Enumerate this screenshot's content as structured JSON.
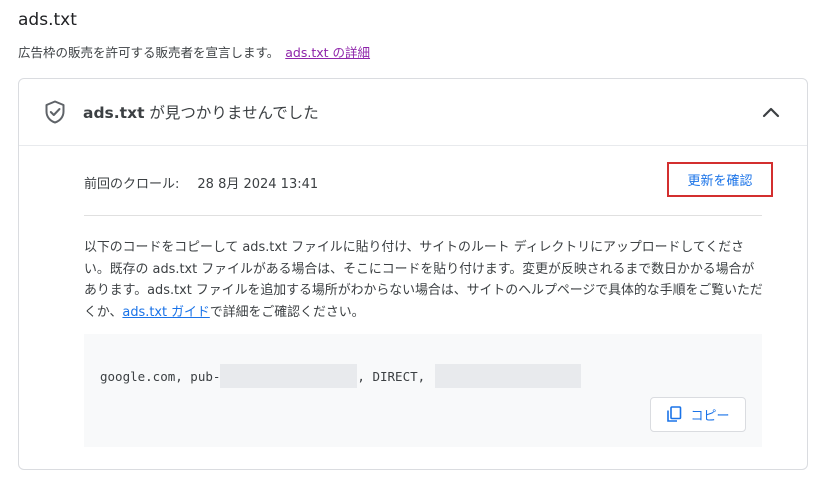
{
  "section": {
    "title": "ads.txt",
    "subtitle": "広告枠の販売を許可する販売者を宣言します。",
    "details_link": "ads.txt の詳細"
  },
  "card": {
    "status_name": "ads.txt",
    "status_text": " が見つかりませんでした",
    "icon": "shield-check-icon",
    "collapse_icon": "chevron-up-icon"
  },
  "crawl": {
    "label": "前回のクロール:",
    "value": "28 8月 2024 13:41",
    "refresh_label": "更新を確認"
  },
  "instructions": {
    "text_before_link": "以下のコードをコピーして ads.txt ファイルに貼り付け、サイトのルート ディレクトリにアップロードしてください。既存の ads.txt ファイルがある場合は、そこにコードを貼り付けます。変更が反映されるまで数日かかる場合があります。ads.txt ファイルを追加する場所がわからない場合は、サイトのヘルプページで具体的な手順をご覧いただくか、",
    "link": "ads.txt ガイド",
    "text_after_link": "で詳細をご確認ください。"
  },
  "code": {
    "part1": "google.com, pub-",
    "part2": ", DIRECT, ",
    "copy_label": "コピー",
    "copy_icon": "copy-icon"
  },
  "colors": {
    "link_visited": "#8e24aa",
    "link": "#1a73e8",
    "highlight_border": "#d32f2f"
  }
}
